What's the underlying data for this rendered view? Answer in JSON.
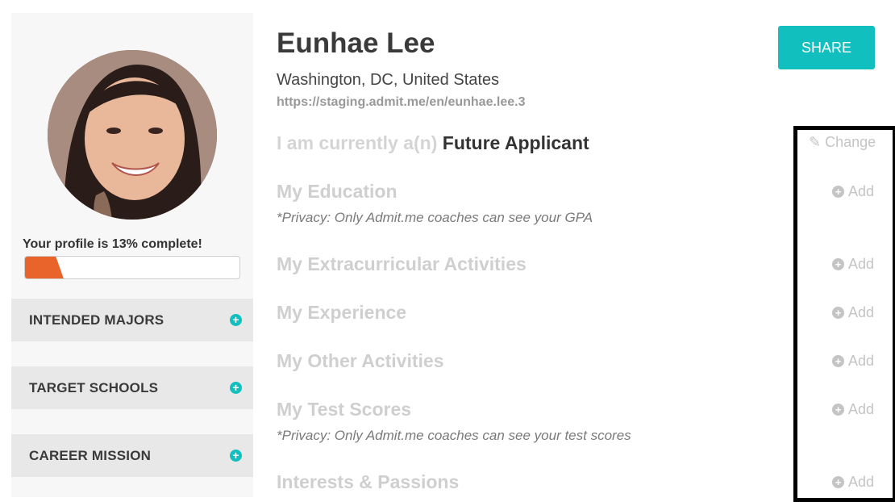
{
  "profile": {
    "name": "Eunhae Lee",
    "location": "Washington, DC, United States",
    "url": "https://staging.admit.me/en/eunhae.lee.3",
    "share_label": "SHARE",
    "progress_text": "Your profile is 13% complete!",
    "progress_value": 0.13
  },
  "status": {
    "prefix": "I am currently a(n)",
    "value": "Future Applicant",
    "change_label": "Change"
  },
  "sections": [
    {
      "title": "My Education",
      "add_label": "Add",
      "privacy": "*Privacy: Only Admit.me coaches can see your GPA"
    },
    {
      "title": "My Extracurricular Activities",
      "add_label": "Add"
    },
    {
      "title": "My Experience",
      "add_label": "Add"
    },
    {
      "title": "My Other Activities",
      "add_label": "Add"
    },
    {
      "title": "My Test Scores",
      "add_label": "Add",
      "privacy": "*Privacy: Only Admit.me coaches can see your test scores"
    },
    {
      "title": "Interests & Passions",
      "add_label": "Add"
    }
  ],
  "sidebar": {
    "panels": [
      {
        "label": "INTENDED MAJORS"
      },
      {
        "label": "TARGET SCHOOLS"
      },
      {
        "label": "CAREER MISSION"
      }
    ]
  },
  "colors": {
    "accent": "#12bfbf",
    "progress": "#e8642a",
    "muted": "#cfcfcf"
  },
  "icons": {
    "avatar": "profile-photo",
    "pencil": "pencil-icon",
    "add": "plus-circle-icon"
  }
}
